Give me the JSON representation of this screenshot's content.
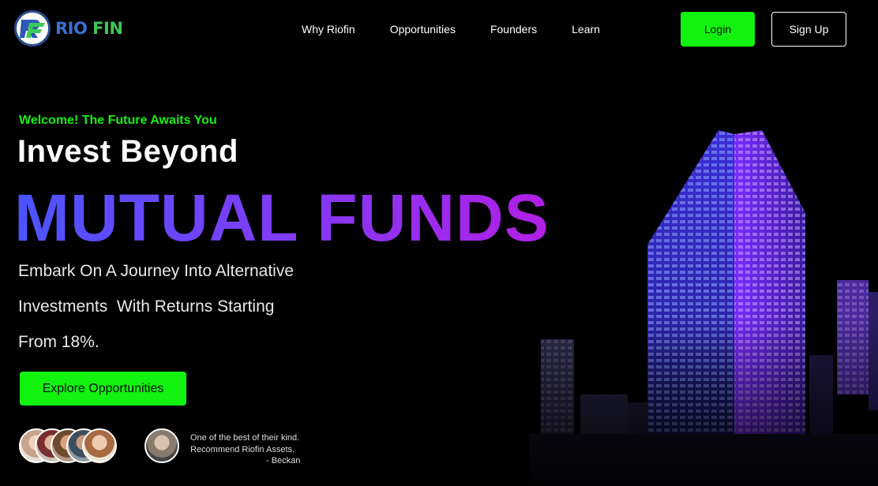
{
  "brand": {
    "name_part1": "RIO",
    "name_part2": "FIN",
    "colors": {
      "blue": "#3a6fd1",
      "green": "#3ec85a"
    }
  },
  "nav": {
    "items": [
      {
        "label": "Why Riofin"
      },
      {
        "label": "Opportunities"
      },
      {
        "label": "Founders"
      },
      {
        "label": "Learn"
      }
    ],
    "login_label": "Login",
    "signup_label": "Sign Up"
  },
  "hero": {
    "welcome": "Welcome! The Future Awaits You",
    "headline": "Invest Beyond",
    "highlight": "MUTUAL FUNDS",
    "subtext_lines": [
      "Embark On A Journey Into Alternative",
      "Investments  With Returns Starting",
      "From 18%."
    ],
    "cta_label": "Explore Opportunities"
  },
  "testimonial": {
    "quote_lines": [
      "One of the best of their kind.",
      "Recommend Riofin Assets."
    ],
    "author": "- Beckan"
  },
  "colors": {
    "accent_green": "#11f20f",
    "gradient_start": "#4a55ff",
    "gradient_end": "#b11fe6",
    "background": "#000000"
  }
}
